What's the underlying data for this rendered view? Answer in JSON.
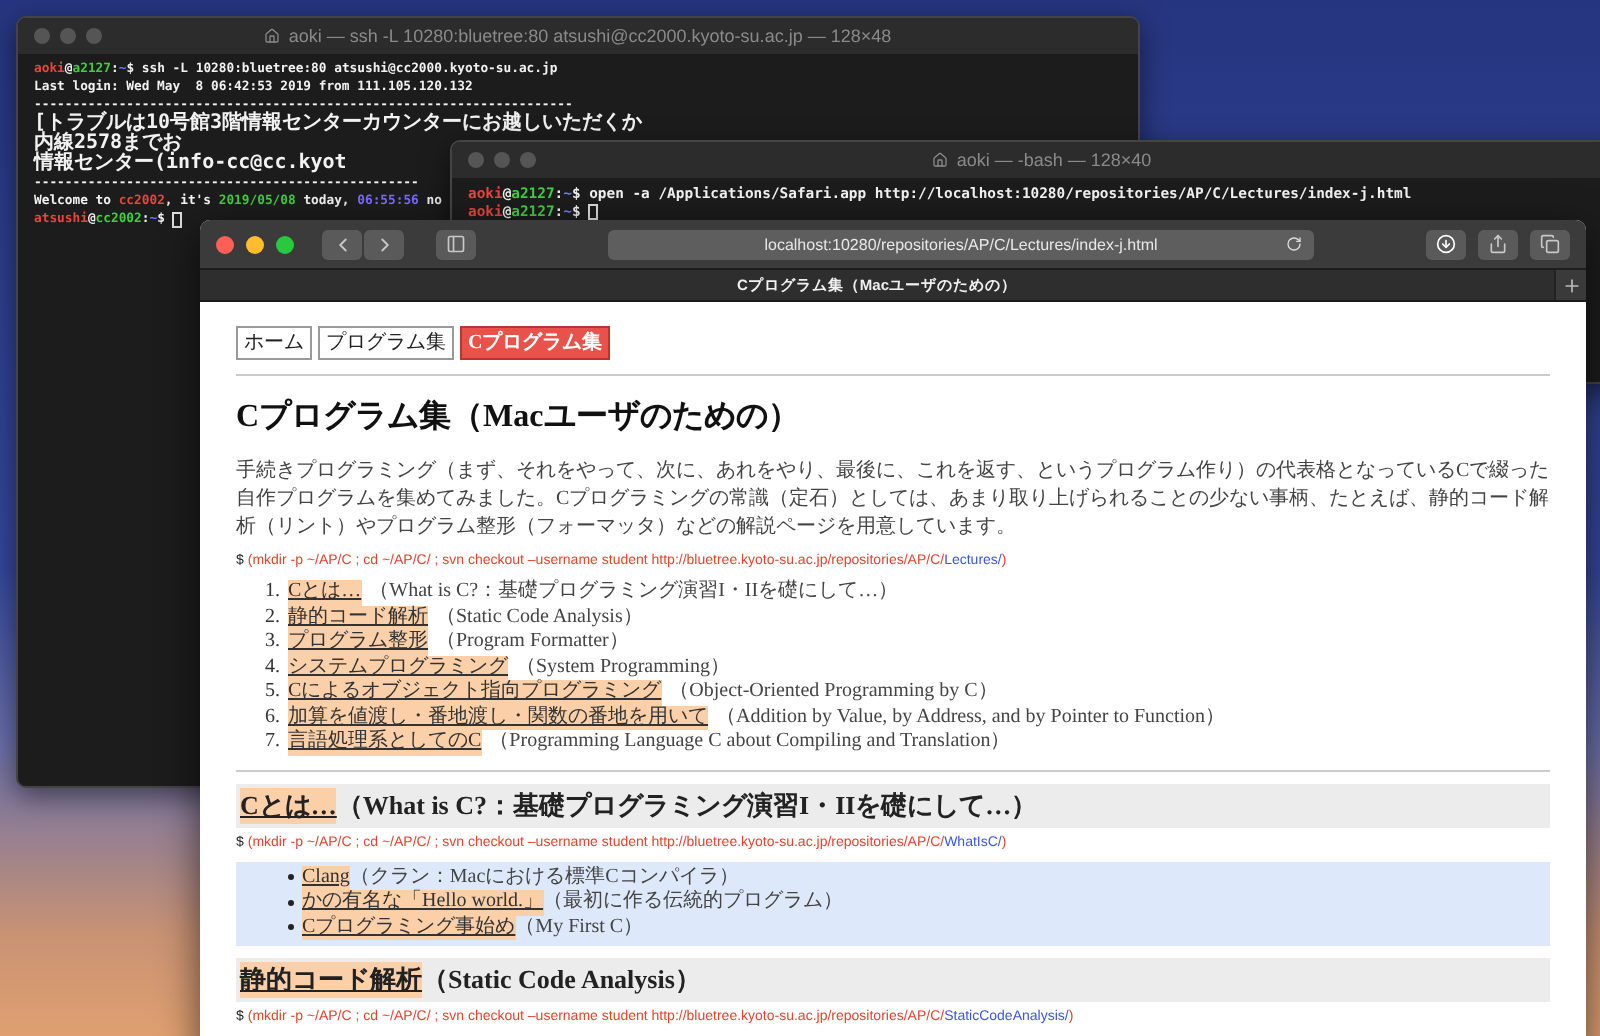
{
  "terminals": [
    {
      "title": "aoki — ssh -L 10280:bluetree:80 atsushi@cc2000.kyoto-su.ac.jp — 128×48",
      "active": false,
      "lines": [
        {
          "segments": [
            {
              "kind": "user",
              "text": "aoki"
            },
            {
              "kind": "plain",
              "text": "@"
            },
            {
              "kind": "host",
              "text": "a2127"
            },
            {
              "kind": "plain",
              "text": ":"
            },
            {
              "kind": "dir",
              "text": "~"
            },
            {
              "kind": "plain",
              "text": "$ ssh -L 10280:bluetree:80 atsushi@cc2000.kyoto-su.ac.jp"
            }
          ]
        },
        {
          "segments": [
            {
              "kind": "plain",
              "text": "Last login: Wed May  8 06:42:53 2019 from 111.105.120.132"
            }
          ]
        },
        {
          "segments": [
            {
              "kind": "plain",
              "text": "----------------------------------------------------------------------"
            }
          ]
        },
        {
          "segments": [
            {
              "kind": "plain",
              "text": "[トラブルは10号館3階情報センターカウンターにお越しいただくか"
            }
          ]
        },
        {
          "segments": [
            {
              "kind": "plain",
              "text": "内線2578までお"
            }
          ]
        },
        {
          "segments": [
            {
              "kind": "plain",
              "text": "情報センター(info-cc@cc.kyot"
            }
          ]
        },
        {
          "segments": [
            {
              "kind": "plain",
              "text": "--------------------------------------------------"
            }
          ]
        },
        {
          "segments": [
            {
              "kind": "plain",
              "text": "Welcome to "
            },
            {
              "kind": "user",
              "text": "cc2002"
            },
            {
              "kind": "plain",
              "text": ", it's "
            },
            {
              "kind": "host",
              "text": "2019/05/08"
            },
            {
              "kind": "plain",
              "text": " today, "
            },
            {
              "kind": "time",
              "text": "06:55:56"
            },
            {
              "kind": "plain",
              "text": " no"
            }
          ]
        },
        {
          "segments": [
            {
              "kind": "user",
              "text": "atsushi"
            },
            {
              "kind": "plain",
              "text": "@"
            },
            {
              "kind": "host",
              "text": "cc2002"
            },
            {
              "kind": "plain",
              "text": ":"
            },
            {
              "kind": "dir",
              "text": "~"
            },
            {
              "kind": "plain",
              "text": "$"
            }
          ]
        }
      ]
    },
    {
      "title": "aoki — -bash — 128×40",
      "active": false,
      "lines": [
        {
          "segments": [
            {
              "kind": "user",
              "text": "aoki"
            },
            {
              "kind": "plain",
              "text": "@"
            },
            {
              "kind": "host",
              "text": "a2127"
            },
            {
              "kind": "plain",
              "text": ":"
            },
            {
              "kind": "dir",
              "text": "~"
            },
            {
              "kind": "plain",
              "text": "$ open -a /Applications/Safari.app http://localhost:10280/repositories/AP/C/Lectures/index-j.html"
            }
          ]
        },
        {
          "segments": [
            {
              "kind": "user",
              "text": "aoki"
            },
            {
              "kind": "plain",
              "text": "@"
            },
            {
              "kind": "host",
              "text": "a2127"
            },
            {
              "kind": "plain",
              "text": ":"
            },
            {
              "kind": "dir",
              "text": "~"
            },
            {
              "kind": "plain",
              "text": "$"
            }
          ]
        }
      ]
    }
  ],
  "browser": {
    "url": "localhost:10280/repositories/AP/C/Lectures/index-j.html",
    "tab_title": "Cプログラム集（Macユーザのための）",
    "nav": [
      {
        "label": "ホーム",
        "selected": false
      },
      {
        "label": "プログラム集",
        "selected": false
      },
      {
        "label": "Cプログラム集",
        "selected": true
      }
    ],
    "heading": "Cプログラム集（Macユーザのための）",
    "intro": "手続きプログラミング（まず、それをやって、次に、あれをやり、最後に、これを返す、というプログラム作り）の代表格となっているCで綴った自作プログラムを集めてみました。Cプログラミングの常識（定石）としては、あまり取り上げられることの少ない事柄、たとえば、静的コード解析（リント）やプログラム整形（フォーマッタ）などの解説ページを用意しています。",
    "command": {
      "prompt": "$",
      "text": "(mkdir -p ~/AP/C ; cd ~/AP/C/ ; svn checkout –username student http://bluetree.kyoto-su.ac.jp/repositories/AP/C/",
      "link": "Lectures/",
      "suffix": ")"
    },
    "toc": [
      {
        "number": "1.",
        "link": "Cとは…",
        "text": "（What is C?：基礎プログラミング演習I・IIを礎にして…）"
      },
      {
        "number": "2.",
        "link": "静的コード解析",
        "text": "（Static Code Analysis）"
      },
      {
        "number": "3.",
        "link": "プログラム整形",
        "text": "（Program Formatter）"
      },
      {
        "number": "4.",
        "link": "システムプログラミング",
        "text": "（System Programming）"
      },
      {
        "number": "5.",
        "link": "Cによるオブジェクト指向プログラミング",
        "text": "（Object-Oriented Programming by C）"
      },
      {
        "number": "6.",
        "link": "加算を値渡し・番地渡し・関数の番地を用いて",
        "text": "（Addition by Value, by Address, and by Pointer to Function）"
      },
      {
        "number": "7.",
        "link": "言語処理系としてのC",
        "text": "（Programming Language C about Compiling and Translation）"
      }
    ],
    "sections": [
      {
        "link": "Cとは…",
        "title": "（What is C?：基礎プログラミング演習I・IIを礎にして…）",
        "command": {
          "prompt": "$",
          "text": "(mkdir -p ~/AP/C ; cd ~/AP/C/ ; svn checkout –username student http://bluetree.kyoto-su.ac.jp/repositories/AP/C/",
          "link": "WhatIsC/",
          "suffix": ")"
        },
        "items": [
          {
            "link": "Clang",
            "text": "（クラン：Macにおける標準Cコンパイラ）"
          },
          {
            "link": "かの有名な「Hello world.」",
            "text": "（最初に作る伝統的プログラム）"
          },
          {
            "link": "Cプログラミング事始め",
            "text": "（My First C）"
          }
        ]
      },
      {
        "link": "静的コード解析",
        "title": "（Static Code Analysis）",
        "command": {
          "prompt": "$",
          "text": "(mkdir -p ~/AP/C ; cd ~/AP/C/ ; svn checkout –username student http://bluetree.kyoto-su.ac.jp/repositories/AP/C/",
          "link": "StaticCodeAnalysis/",
          "suffix": ")"
        }
      }
    ]
  }
}
